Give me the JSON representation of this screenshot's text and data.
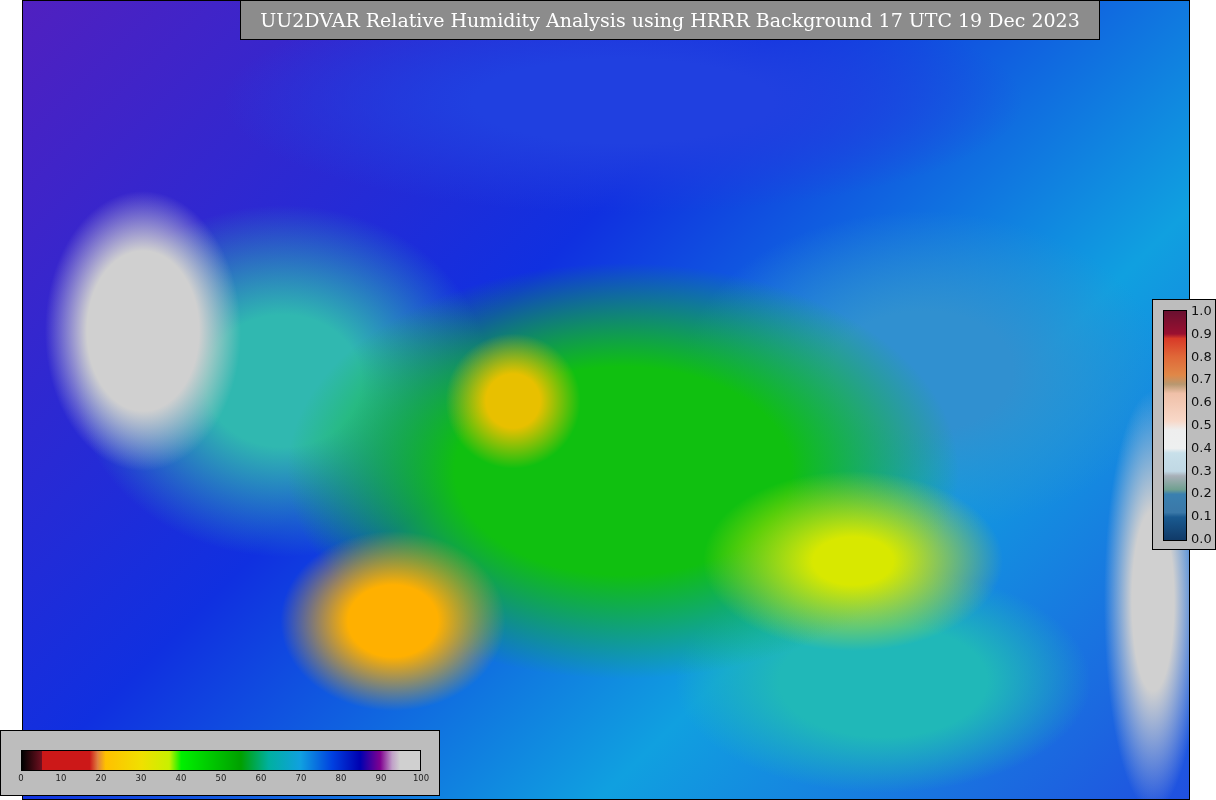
{
  "title": "UU2DVAR Relative Humidity Analysis using HRRR Background 17 UTC 19 Dec 2023",
  "colorbar_right": {
    "ticks": [
      "1.0",
      "0.9",
      "0.8",
      "0.7",
      "0.6",
      "0.5",
      "0.4",
      "0.3",
      "0.2",
      "0.1",
      "0.0"
    ]
  },
  "colorbar_bottom": {
    "ticks": [
      "0",
      "10",
      "20",
      "30",
      "40",
      "50",
      "60",
      "70",
      "80",
      "90",
      "100"
    ]
  }
}
